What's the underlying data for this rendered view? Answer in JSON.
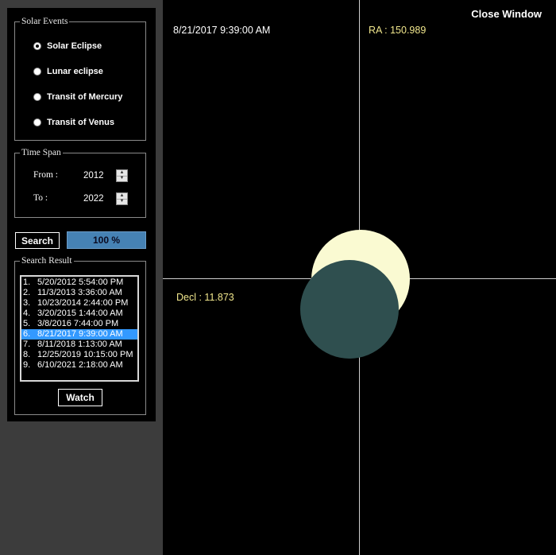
{
  "solar_events": {
    "legend": "Solar Events",
    "options": [
      {
        "label": "Solar Eclipse",
        "checked": true
      },
      {
        "label": "Lunar eclipse",
        "checked": false
      },
      {
        "label": "Transit of Mercury",
        "checked": false
      },
      {
        "label": "Transit of Venus",
        "checked": false
      }
    ]
  },
  "time_span": {
    "legend": "Time Span",
    "from_label": "From :",
    "from_value": "2012",
    "to_label": "To :",
    "to_value": "2022"
  },
  "search": {
    "button_label": "Search",
    "progress_text": "100 %",
    "progress": 1.0
  },
  "search_result": {
    "legend": "Search Result",
    "items": [
      {
        "num": "1.",
        "date": "5/20/2012 5:54:00 PM"
      },
      {
        "num": "2.",
        "date": "11/3/2013 3:36:00 AM"
      },
      {
        "num": "3.",
        "date": "10/23/2014 2:44:00 PM"
      },
      {
        "num": "4.",
        "date": "3/20/2015 1:44:00 AM"
      },
      {
        "num": "5.",
        "date": "3/8/2016 7:44:00 PM"
      },
      {
        "num": "6.",
        "date": "8/21/2017 9:39:00 AM"
      },
      {
        "num": "7.",
        "date": "8/11/2018 1:13:00 AM"
      },
      {
        "num": "8.",
        "date": "12/25/2019 10:15:00 PM"
      },
      {
        "num": "9.",
        "date": "6/10/2021 2:18:00 AM"
      }
    ],
    "selected_index": 5,
    "watch_label": "Watch"
  },
  "viewer": {
    "datetime": "8/21/2017 9:39:00 AM",
    "ra": "RA : 150.989",
    "decl": "Decl : 11.873",
    "close_label": "Close Window"
  },
  "colors": {
    "sun": "#fafad2",
    "moon": "#2f4f4f",
    "coord_text": "#f0e68c",
    "selection": "#3399ff",
    "progress": "#4682b4"
  }
}
